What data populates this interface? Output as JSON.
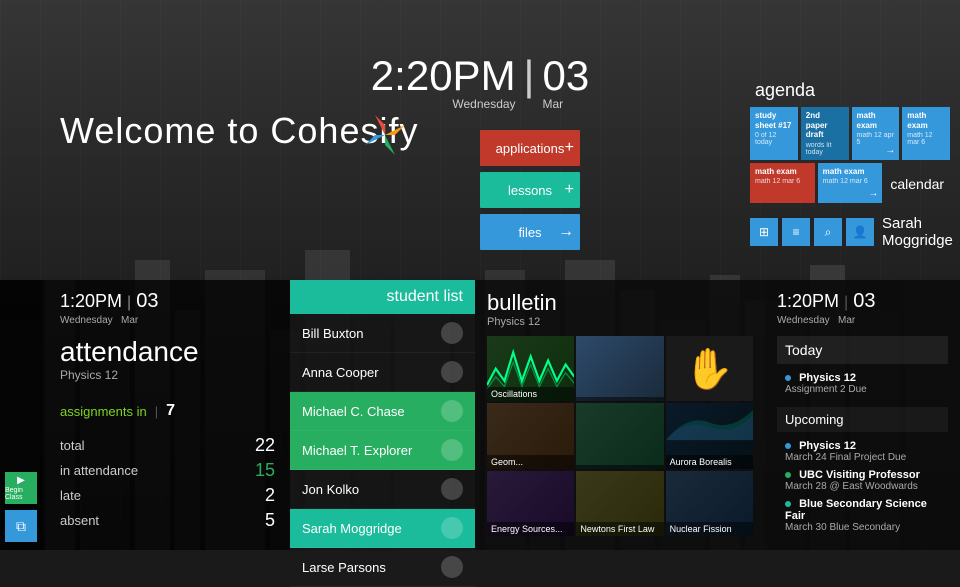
{
  "app": {
    "title": "Cohesify",
    "welcome": "Welcome to Cohesify"
  },
  "clock": {
    "time": "2:20PM",
    "day_name": "Wednesday",
    "day_num": "03",
    "month": "Mar"
  },
  "quick_tiles": [
    {
      "label": "applications",
      "color": "red"
    },
    {
      "label": "lessons",
      "color": "teal"
    },
    {
      "label": "files",
      "color": "blue"
    }
  ],
  "agenda": {
    "label": "agenda",
    "tiles": [
      {
        "title": "study sheet #17",
        "sub": "0 of 12 today",
        "variant": "blue"
      },
      {
        "title": "2nd paper draft",
        "sub": "words lit today",
        "variant": "dark"
      },
      {
        "title": "math exam",
        "sub": "math 12 apr 5",
        "variant": "blue"
      },
      {
        "title": "math exam",
        "sub": "math 12 mar 6",
        "variant": "red"
      },
      {
        "title": "math exam",
        "sub": "math 12 mar 6",
        "variant": "blue"
      }
    ],
    "calendar_label": "calendar"
  },
  "profile": {
    "name": "Sarah Moggridge",
    "icons": [
      "⊞",
      "≡",
      "⌕",
      "👤"
    ]
  },
  "attendance": {
    "time": "1:20PM",
    "day_num": "03",
    "day_name": "Wednesday",
    "month": "Mar",
    "title": "attendance",
    "subtitle": "Physics 12",
    "assignments_label": "assignments in",
    "assignments_count": "7",
    "stats": [
      {
        "label": "total",
        "value": "22",
        "green": false
      },
      {
        "label": "in attendance",
        "value": "15",
        "green": false
      },
      {
        "label": "late",
        "value": "2",
        "green": false
      },
      {
        "label": "absent",
        "value": "5",
        "green": false
      }
    ]
  },
  "student_list": {
    "header": "student list",
    "students": [
      {
        "name": "Bill Buxton",
        "active": false
      },
      {
        "name": "Anna Cooper",
        "active": false
      },
      {
        "name": "Michael C. Chase",
        "active": true
      },
      {
        "name": "Michael T. Explorer",
        "active": true
      },
      {
        "name": "Jon Kolko",
        "active": false
      },
      {
        "name": "Sarah Moggridge",
        "active": true
      },
      {
        "name": "Larse Parsons",
        "active": false
      }
    ]
  },
  "bulletin": {
    "title": "bulletin",
    "subtitle": "Physics 12",
    "cells": [
      {
        "label": "Oscillations",
        "type": "wave"
      },
      {
        "label": "",
        "type": "photo"
      },
      {
        "label": "",
        "type": "hand"
      },
      {
        "label": "Geom...",
        "type": "photo"
      },
      {
        "label": "",
        "type": "photo"
      },
      {
        "label": "Aurora Borealis",
        "type": "photo"
      },
      {
        "label": "Energy Sources...",
        "type": "photo"
      },
      {
        "label": "Newtons First Law",
        "type": "photo"
      },
      {
        "label": "Nuclear Fission",
        "type": "photo"
      }
    ]
  },
  "schedule": {
    "time": "1:20PM",
    "day_num": "03",
    "day_name": "Wednesday",
    "month": "Mar",
    "today_label": "Today",
    "today_items": [
      {
        "subject": "Physics 12",
        "detail": "Assignment 2 Due"
      }
    ],
    "upcoming_label": "Upcoming",
    "upcoming_items": [
      {
        "subject": "Physics 12",
        "detail": "March 24 Final Project Due",
        "color": "blue"
      },
      {
        "subject": "UBC Visiting Professor",
        "detail": "March 28 @ East Woodwards",
        "color": "green"
      },
      {
        "subject": "Blue Secondary Science Fair",
        "detail": "March 30 Blue Secondary",
        "color": "teal"
      }
    ]
  }
}
